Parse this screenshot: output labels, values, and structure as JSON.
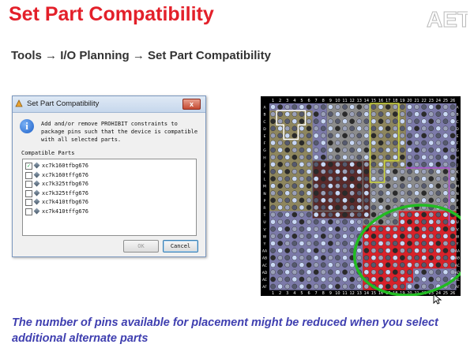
{
  "slide": {
    "title": "Set Part Compatibility",
    "logo_text": "AET",
    "menu_path": "Tools → I/O Planning → Set Part Compatibility",
    "caption": "The number of pins available for placement might be reduced when you select additional alternate parts"
  },
  "dialog": {
    "title": "Set Part Compatibility",
    "close_label": "x",
    "message": "Add and/or remove PROHIBIT constraints to\npackage pins such that the device is compatible\nwith all selected parts.",
    "group_label": "Compatible Parts",
    "parts": [
      {
        "label": "xc7k160tfbg676",
        "checked": true
      },
      {
        "label": "xc7k160tffg676",
        "checked": false
      },
      {
        "label": "xc7k325tfbg676",
        "checked": false
      },
      {
        "label": "xc7k325tffg676",
        "checked": false
      },
      {
        "label": "xc7k410tfbg676",
        "checked": false
      },
      {
        "label": "xc7k410tffg676",
        "checked": false
      }
    ],
    "ok_label": "OK",
    "cancel_label": "Cancel"
  },
  "pin_map": {
    "columns": [
      "1",
      "2",
      "3",
      "4",
      "5",
      "6",
      "7",
      "8",
      "9",
      "10",
      "11",
      "12",
      "13",
      "14",
      "15",
      "16",
      "17",
      "18",
      "19",
      "20",
      "21",
      "22",
      "23",
      "24",
      "25",
      "26"
    ],
    "rows": [
      "A",
      "B",
      "C",
      "D",
      "E",
      "F",
      "G",
      "H",
      "J",
      "K",
      "L",
      "M",
      "N",
      "P",
      "R",
      "T",
      "U",
      "V",
      "W",
      "Y",
      "AA",
      "AB",
      "AC",
      "AD",
      "AE",
      "AF"
    ],
    "colors": {
      "background": "#000000",
      "bank_blue": "#7c7aa9",
      "bank_gray": "#8c8c8c",
      "bank_tan": "#8e865e",
      "highlight_red": "#d8222a",
      "ellipse_green": "#22bb22"
    }
  }
}
